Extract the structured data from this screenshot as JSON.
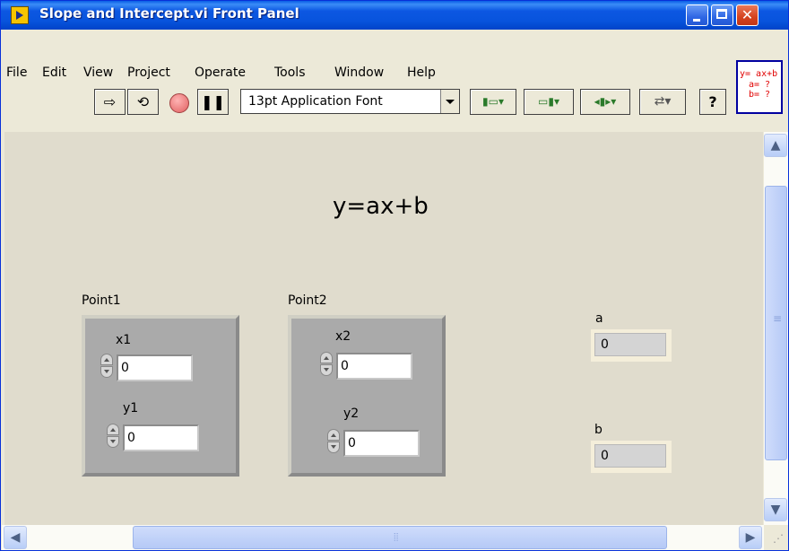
{
  "window": {
    "title": "Slope and Intercept.vi Front Panel"
  },
  "menu": [
    "File",
    "Edit",
    "View",
    "Project",
    "Operate",
    "Tools",
    "Window",
    "Help"
  ],
  "toolbar": {
    "font": "13pt Application Font"
  },
  "vi_icon": {
    "lines": [
      "y= ax+b",
      "a= ?",
      "b= ?"
    ]
  },
  "panel": {
    "equation": "y=ax+b",
    "point1": {
      "label": "Point1",
      "x_label": "x1",
      "x_value": "0",
      "y_label": "y1",
      "y_value": "0"
    },
    "point2": {
      "label": "Point2",
      "x_label": "x2",
      "x_value": "0",
      "y_label": "y2",
      "y_value": "0"
    },
    "a": {
      "label": "a",
      "value": "0"
    },
    "b": {
      "label": "b",
      "value": "0"
    }
  },
  "colors": {
    "titlebar": "#0854dd",
    "panel_bg": "#e0dccd",
    "cluster_bg": "#aaaaaa",
    "indicator_bg": "#d4d4d4"
  }
}
